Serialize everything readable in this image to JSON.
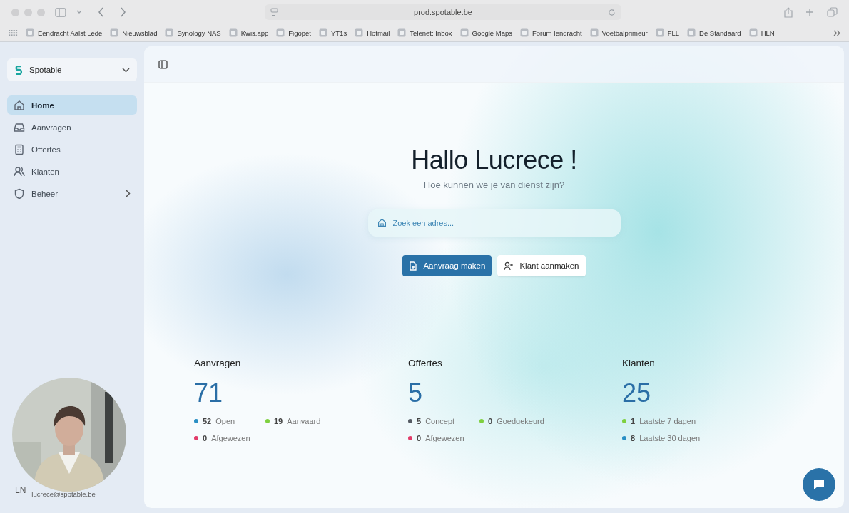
{
  "browser": {
    "url": "prod.spotable.be",
    "bookmarks": [
      {
        "label": "Eendracht Aalst Lede"
      },
      {
        "label": "Nieuwsblad"
      },
      {
        "label": "Synology NAS"
      },
      {
        "label": "Kwis.app"
      },
      {
        "label": "Figopet"
      },
      {
        "label": "YT1s"
      },
      {
        "label": "Hotmail"
      },
      {
        "label": "Telenet: Inbox"
      },
      {
        "label": "Google Maps"
      },
      {
        "label": "Forum Iendracht"
      },
      {
        "label": "Voetbalprimeur"
      },
      {
        "label": "FLL"
      },
      {
        "label": "De Standaard"
      },
      {
        "label": "HLN"
      }
    ]
  },
  "sidebar": {
    "workspace": "Spotable",
    "items": [
      {
        "label": "Home",
        "kind": "home",
        "selected": true,
        "has_submenu": false
      },
      {
        "label": "Aanvragen",
        "kind": "inbox",
        "selected": false,
        "has_submenu": false
      },
      {
        "label": "Offertes",
        "kind": "calculator",
        "selected": false,
        "has_submenu": false
      },
      {
        "label": "Klanten",
        "kind": "users",
        "selected": false,
        "has_submenu": false
      },
      {
        "label": "Beheer",
        "kind": "shield",
        "selected": false,
        "has_submenu": true
      }
    ],
    "user": {
      "initials": "LN",
      "email": "lucrece@spotable.be"
    }
  },
  "hero": {
    "greeting": "Hallo Lucrece !",
    "subtitle": "Hoe kunnen we je van dienst zijn?",
    "search": {
      "placeholder": "Zoek een adres..."
    },
    "buttons": [
      {
        "label": "Aanvraag maken",
        "kind": "primary"
      },
      {
        "label": "Klant aanmaken",
        "kind": "secondary"
      }
    ]
  },
  "stats": [
    {
      "title": "Aanvragen",
      "value": "71",
      "breakdown": [
        {
          "count": "52",
          "label": "Open",
          "color": "#2a8fc4"
        },
        {
          "count": "19",
          "label": "Aanvaard",
          "color": "#7ed03f"
        },
        {
          "count": "0",
          "label": "Afgewezen",
          "color": "#e23c6a"
        }
      ]
    },
    {
      "title": "Offertes",
      "value": "5",
      "breakdown": [
        {
          "count": "5",
          "label": "Concept",
          "color": "#555b63"
        },
        {
          "count": "0",
          "label": "Goedgekeurd",
          "color": "#7ed03f"
        },
        {
          "count": "0",
          "label": "Afgewezen",
          "color": "#e23c6a"
        }
      ]
    },
    {
      "title": "Klanten",
      "value": "25",
      "breakdown": [
        {
          "count": "1",
          "label": "Laatste 7 dagen",
          "color": "#7ed03f"
        },
        {
          "count": "8",
          "label": "Laatste 30 dagen",
          "color": "#2a8fc4"
        }
      ]
    }
  ]
}
